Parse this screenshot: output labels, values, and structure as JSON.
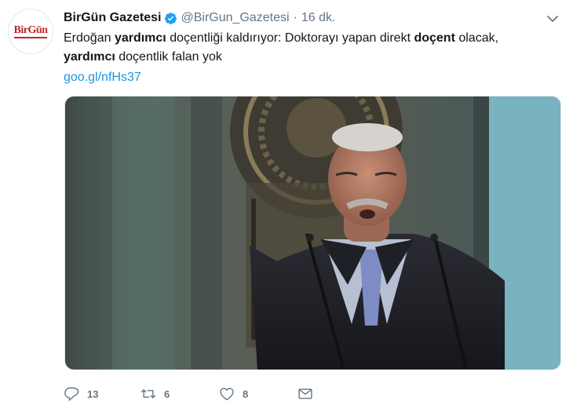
{
  "tweet": {
    "author": {
      "name": "BirGün Gazetesi",
      "handle": "@BirGun_Gazetesi",
      "avatar_text": "BirGün",
      "verified": true
    },
    "separator": "·",
    "timestamp": "16 dk.",
    "text": {
      "l1_a": "Erdoğan ",
      "l1_b": "yardımcı",
      "l1_c": " doçentliği kaldırıyor: Doktorayı yapan direkt ",
      "l1_d": "doçent",
      "l1_e": " olacak,",
      "l2_a": "yardımcı",
      "l2_b": " doçentlik falan yok"
    },
    "link": "goo.gl/nfHs37",
    "actions": {
      "reply_count": "13",
      "retweet_count": "6",
      "like_count": "8"
    }
  },
  "icons": {
    "verified": "verified-badge-icon",
    "caret": "chevron-down-icon",
    "reply": "reply-icon",
    "retweet": "retweet-icon",
    "like": "heart-icon",
    "dm": "envelope-icon"
  },
  "colors": {
    "link": "#1b95e0",
    "muted": "#657786",
    "verified": "#1da1f2",
    "brand_red": "#c1272d"
  }
}
